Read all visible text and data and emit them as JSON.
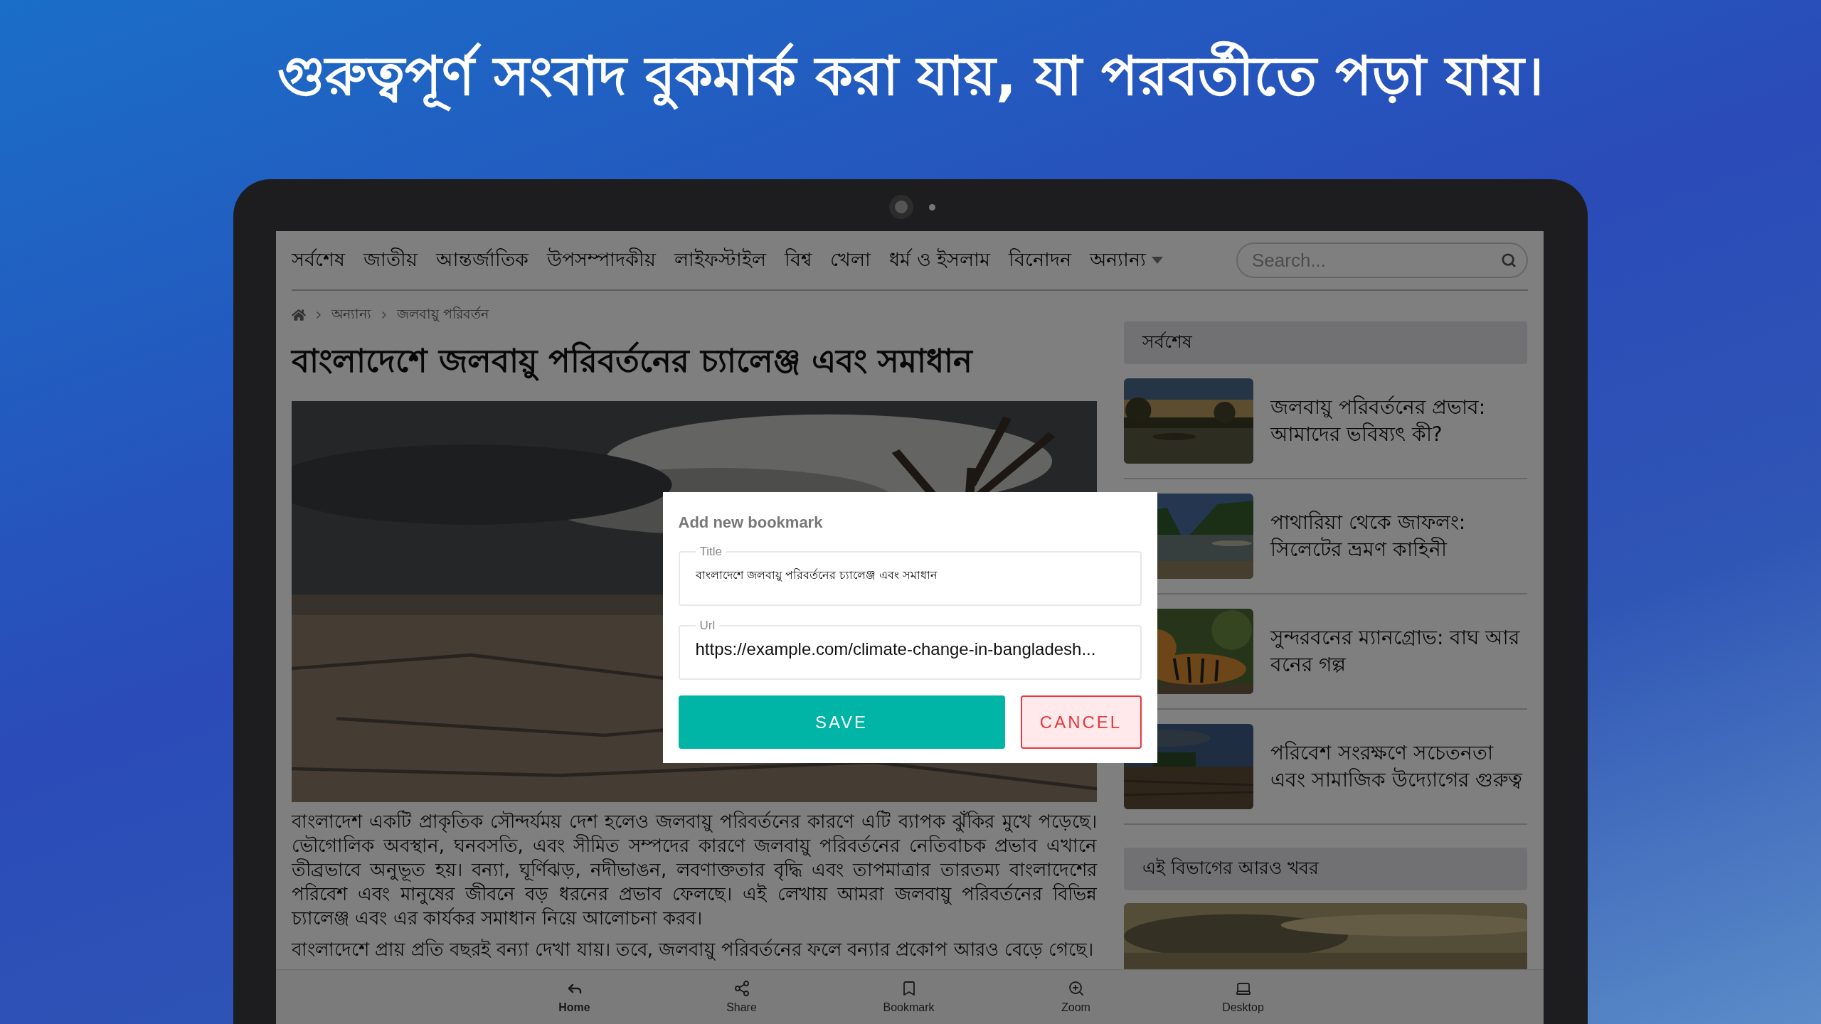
{
  "headline": "গুরুত্বপূর্ণ সংবাদ বুকমার্ক করা যায়, যা পরবর্তীতে পড়া যায়।",
  "nav": {
    "items": [
      {
        "label": "সর্বশেষ",
        "dropdown": false
      },
      {
        "label": "জাতীয়",
        "dropdown": false
      },
      {
        "label": "আন্তর্জাতিক",
        "dropdown": false
      },
      {
        "label": "উপসম্পাদকীয়",
        "dropdown": false
      },
      {
        "label": "লাইফস্টাইল",
        "dropdown": false
      },
      {
        "label": "বিশ্ব",
        "dropdown": false
      },
      {
        "label": "খেলা",
        "dropdown": false
      },
      {
        "label": "ধর্ম ও ইসলাম",
        "dropdown": false
      },
      {
        "label": "বিনোদন",
        "dropdown": false
      },
      {
        "label": "অন্যান্য",
        "dropdown": true
      }
    ],
    "search": {
      "placeholder": "Search..."
    }
  },
  "breadcrumb": [
    "অন্যান্য",
    "জলবায়ু পরিবর্তন"
  ],
  "article": {
    "title": "বাংলাদেশে জলবায়ু পরিবর্তনের চ্যালেঞ্জ এবং সমাধান",
    "paragraphs": [
      "বাংলাদেশ একটি প্রাকৃতিক সৌন্দর্যময় দেশ হলেও জলবায়ু পরিবর্তনের কারণে এটি ব্যাপক ঝুঁকির মুখে পড়েছে। ভৌগোলিক অবস্থান, ঘনবসতি, এবং সীমিত সম্পদের কারণে জলবায়ু পরিবর্তনের নেতিবাচক প্রভাব এখানে তীব্রভাবে অনুভূত হয়। বন্যা, ঘূর্ণিঝড়, নদীভাঙন, লবণাক্ততার বৃদ্ধি এবং তাপমাত্রার তারতম্য বাংলাদেশের পরিবেশ এবং মানুষের জীবনে বড় ধরনের প্রভাব ফেলছে। এই লেখায় আমরা জলবায়ু পরিবর্তনের বিভিন্ন চ্যালেঞ্জ এবং এর কার্যকর সমাধান নিয়ে আলোচনা করব।",
      "বাংলাদেশে প্রায় প্রতি বছরই বন্যা দেখা যায়। তবে, জলবায়ু পরিবর্তনের ফলে বন্যার প্রকোপ আরও বেড়ে গেছে।"
    ]
  },
  "sidebar": {
    "latest_heading": "সর্বশেষ",
    "latest": [
      {
        "title": "জলবায়ু পরিবর্তনের প্রভাব: আমাদের ভবিষ্যৎ কী?"
      },
      {
        "title": "পাথারিয়া থেকে জাফলং: সিলেটের ভ্রমণ কাহিনী"
      },
      {
        "title": "সুন্দরবনের ম্যানগ্রোভ: বাঘ আর বনের গল্প"
      },
      {
        "title": "পরিবেশ সংরক্ষণে সচেতনতা এবং সামাজিক উদ্যোগের গুরুত্ব"
      }
    ],
    "more_heading": "এই বিভাগের আরও খবর"
  },
  "dialog": {
    "title": "Add new bookmark",
    "fields": [
      {
        "label": "Title",
        "value": "বাংলাদেশে জলবায়ু পরিবর্তনের চ্যালেঞ্জ এবং সমাধান",
        "kind": "bengali"
      },
      {
        "label": "Url",
        "value": "https://example.com/climate-change-in-bangladesh...",
        "kind": "latin"
      }
    ],
    "buttons": [
      {
        "label": "SAVE",
        "kind": "primary"
      },
      {
        "label": "CANCEL",
        "kind": "cancel"
      }
    ]
  },
  "bottom_nav": [
    {
      "label": "Home",
      "kind": "home",
      "selected": true
    },
    {
      "label": "Share",
      "kind": "share",
      "selected": false
    },
    {
      "label": "Bookmark",
      "kind": "bookmark",
      "selected": false
    },
    {
      "label": "Zoom",
      "kind": "zoom",
      "selected": false
    },
    {
      "label": "Desktop",
      "kind": "desktop",
      "selected": false
    }
  ]
}
